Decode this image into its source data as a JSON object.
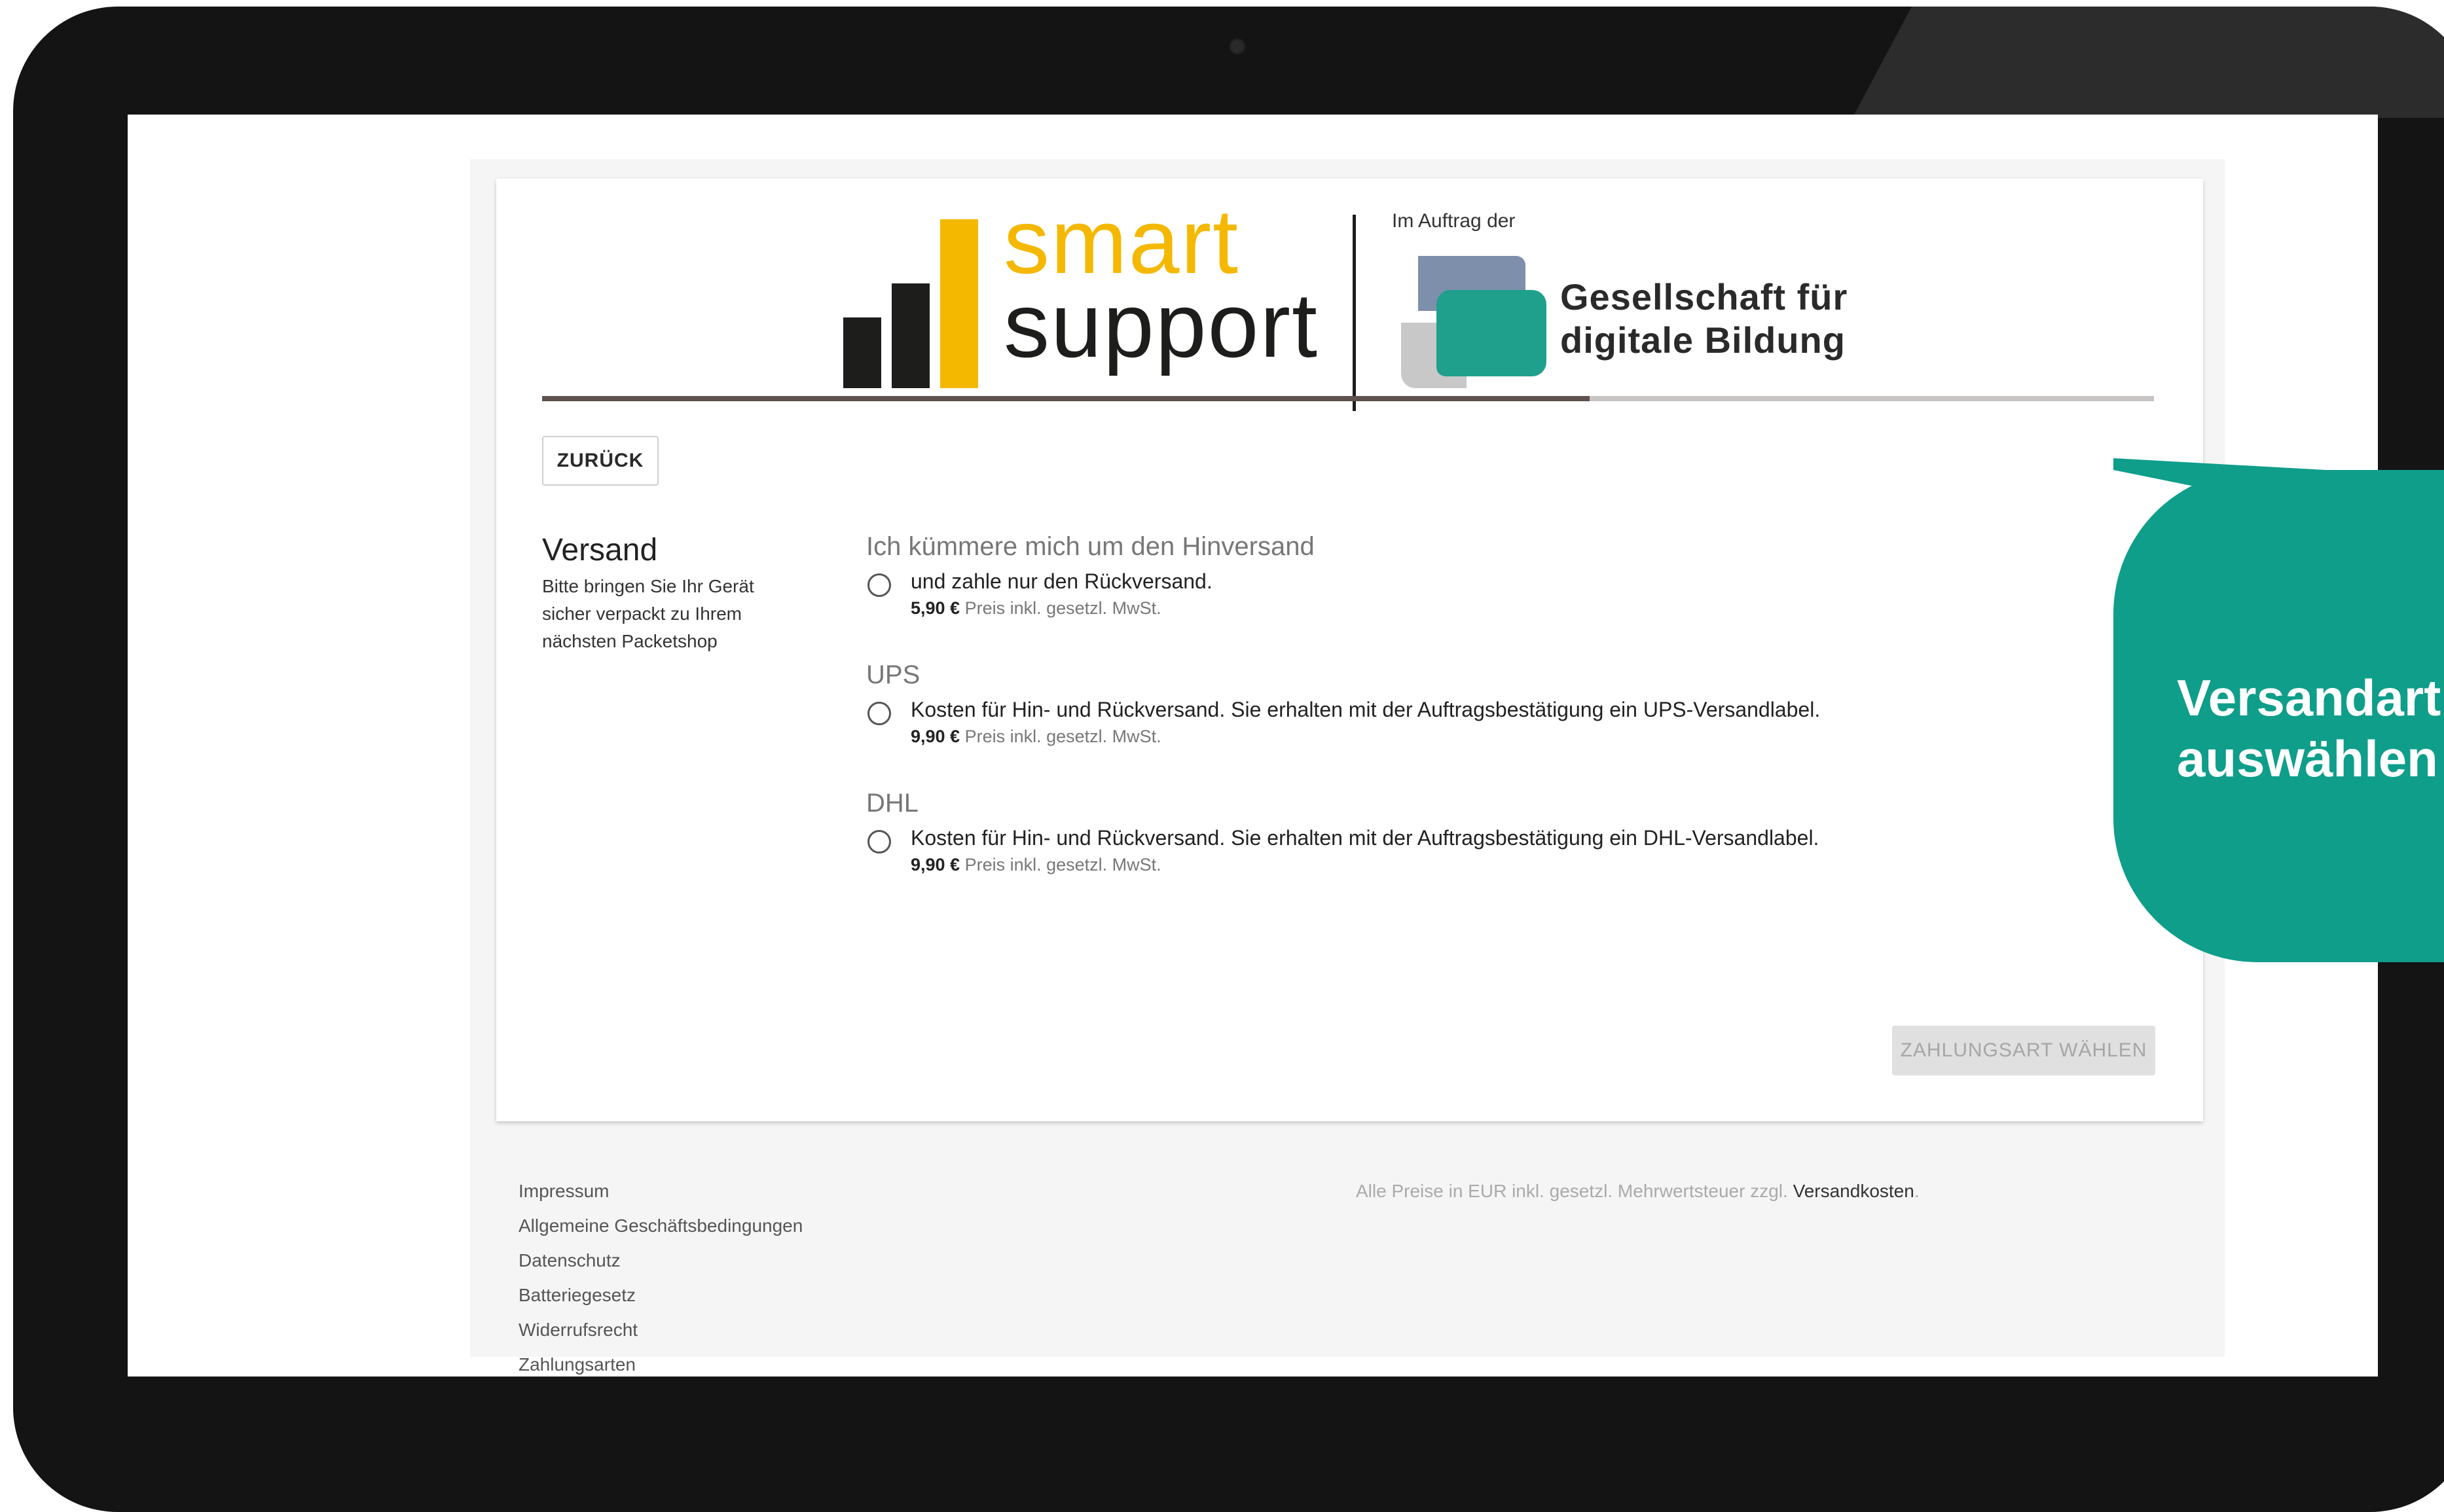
{
  "header": {
    "logo_word_1": "smart",
    "logo_word_2": "support",
    "commission_label": "Im Auftrag der",
    "partner_name_line1": "Gesellschaft für",
    "partner_name_line2": "digitale Bildung"
  },
  "progress": {
    "fraction": 0.65
  },
  "back_button": "ZURÜCK",
  "section": {
    "title": "Versand",
    "description": "Bitte bringen Sie Ihr Gerät sicher verpackt zu Ihrem nächsten Packetshop"
  },
  "shipping_options": [
    {
      "title": "Ich kümmere mich um den Hinversand",
      "description": "und zahle nur den Rückversand.",
      "price": "5,90 €",
      "price_note": "Preis inkl. gesetzl. MwSt.",
      "selected": false
    },
    {
      "title": "UPS",
      "description": "Kosten für Hin- und Rückversand. Sie erhalten mit der Auftragsbestätigung ein UPS-Versandlabel.",
      "price": "9,90 €",
      "price_note": "Preis inkl. gesetzl. MwSt.",
      "selected": false
    },
    {
      "title": "DHL",
      "description": "Kosten für Hin- und Rückversand. Sie erhalten mit der Auftragsbestätigung ein DHL-Versandlabel.",
      "price": "9,90 €",
      "price_note": "Preis inkl. gesetzl. MwSt.",
      "selected": false
    }
  ],
  "next_button": "ZAHLUNGSART WÄHLEN",
  "footer": {
    "links": [
      "Impressum",
      "Allgemeine Geschäftsbedingungen",
      "Datenschutz",
      "Batteriegesetz",
      "Widerrufsrecht",
      "Zahlungsarten"
    ],
    "price_note_prefix": "Alle Preise in EUR inkl. gesetzl. Mehrwertsteuer zzgl.",
    "price_note_link": "Versandkosten",
    "price_note_suffix": "."
  },
  "callout": {
    "line1": "Versandart",
    "line2": "auswählen"
  },
  "colors": {
    "brand_yellow": "#f5b800",
    "callout_teal": "#0e9e8a",
    "partner_teal": "#1fa08c",
    "partner_blue": "#7d8fab"
  }
}
